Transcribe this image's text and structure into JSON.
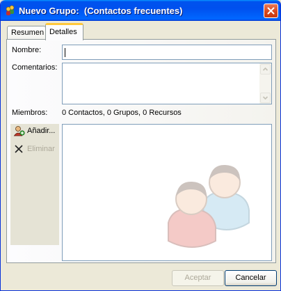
{
  "window": {
    "title": "Nuevo Grupo:  (Contactos frecuentes)",
    "icon": "contacts-group-icon",
    "close_icon": "close-icon"
  },
  "tabs": [
    {
      "label": "Resumen",
      "selected": false
    },
    {
      "label": "Detalles",
      "selected": true
    }
  ],
  "form": {
    "name_label": "Nombre:",
    "name_value": "",
    "comments_label": "Comentarios:",
    "comments_value": "",
    "members_label": "Miembros:",
    "members_summary": "0 Contactos, 0 Grupos, 0 Recursos"
  },
  "member_actions": {
    "add_label": "Añadir...",
    "add_icon": "add-contact-icon",
    "remove_label": "Eliminar",
    "remove_icon": "remove-x-icon",
    "remove_enabled": false
  },
  "buttons": {
    "accept_label": "Aceptar",
    "accept_enabled": false,
    "cancel_label": "Cancelar"
  },
  "colors": {
    "titlebar": "#0053ee",
    "dialog_bg": "#ece9d8",
    "tab_highlight": "#ffc83c",
    "disabled_text": "#aca899"
  }
}
